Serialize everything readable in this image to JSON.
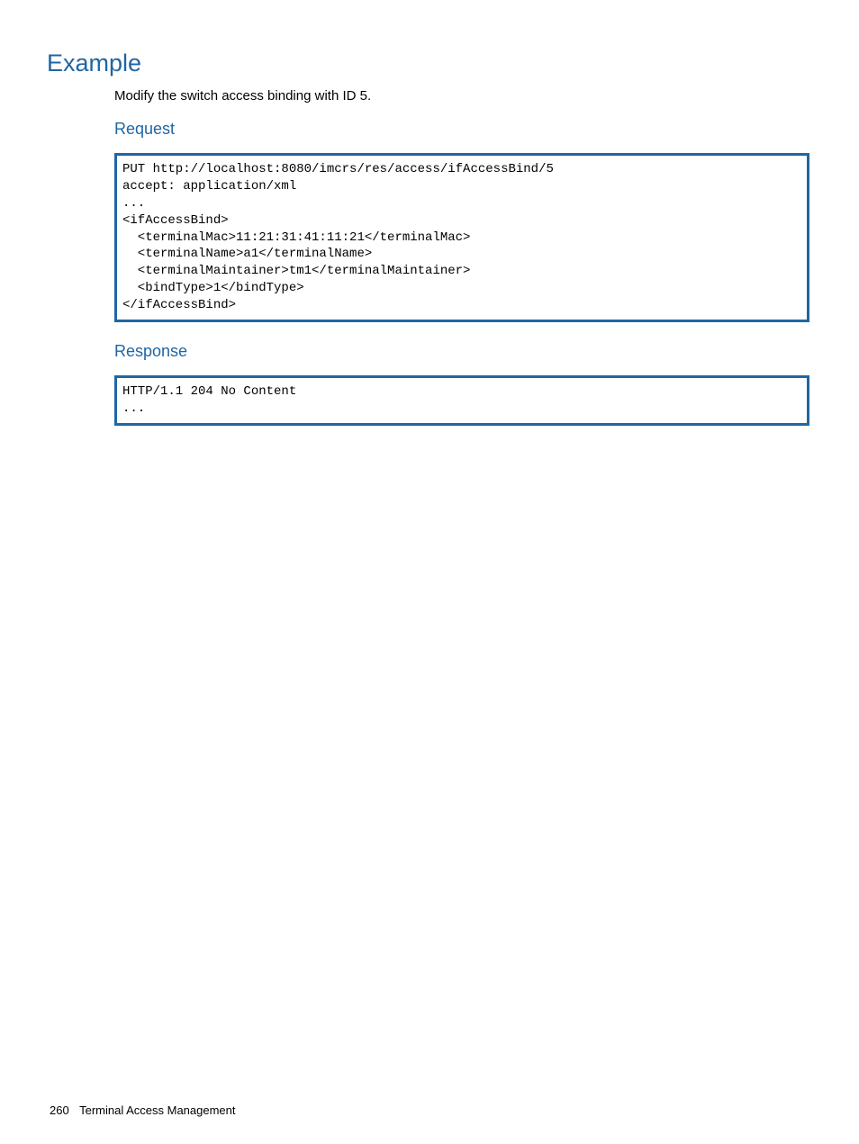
{
  "headings": {
    "example": "Example",
    "request": "Request",
    "response": "Response"
  },
  "description": "Modify the switch access binding with ID 5.",
  "request_code": "PUT http://localhost:8080/imcrs/res/access/ifAccessBind/5\naccept: application/xml\n...\n<ifAccessBind>\n  <terminalMac>11:21:31:41:11:21</terminalMac>\n  <terminalName>a1</terminalName>\n  <terminalMaintainer>tm1</terminalMaintainer>\n  <bindType>1</bindType>\n</ifAccessBind>",
  "response_code": "HTTP/1.1 204 No Content\n...",
  "footer": {
    "page_number": "260",
    "section": "Terminal Access Management"
  }
}
